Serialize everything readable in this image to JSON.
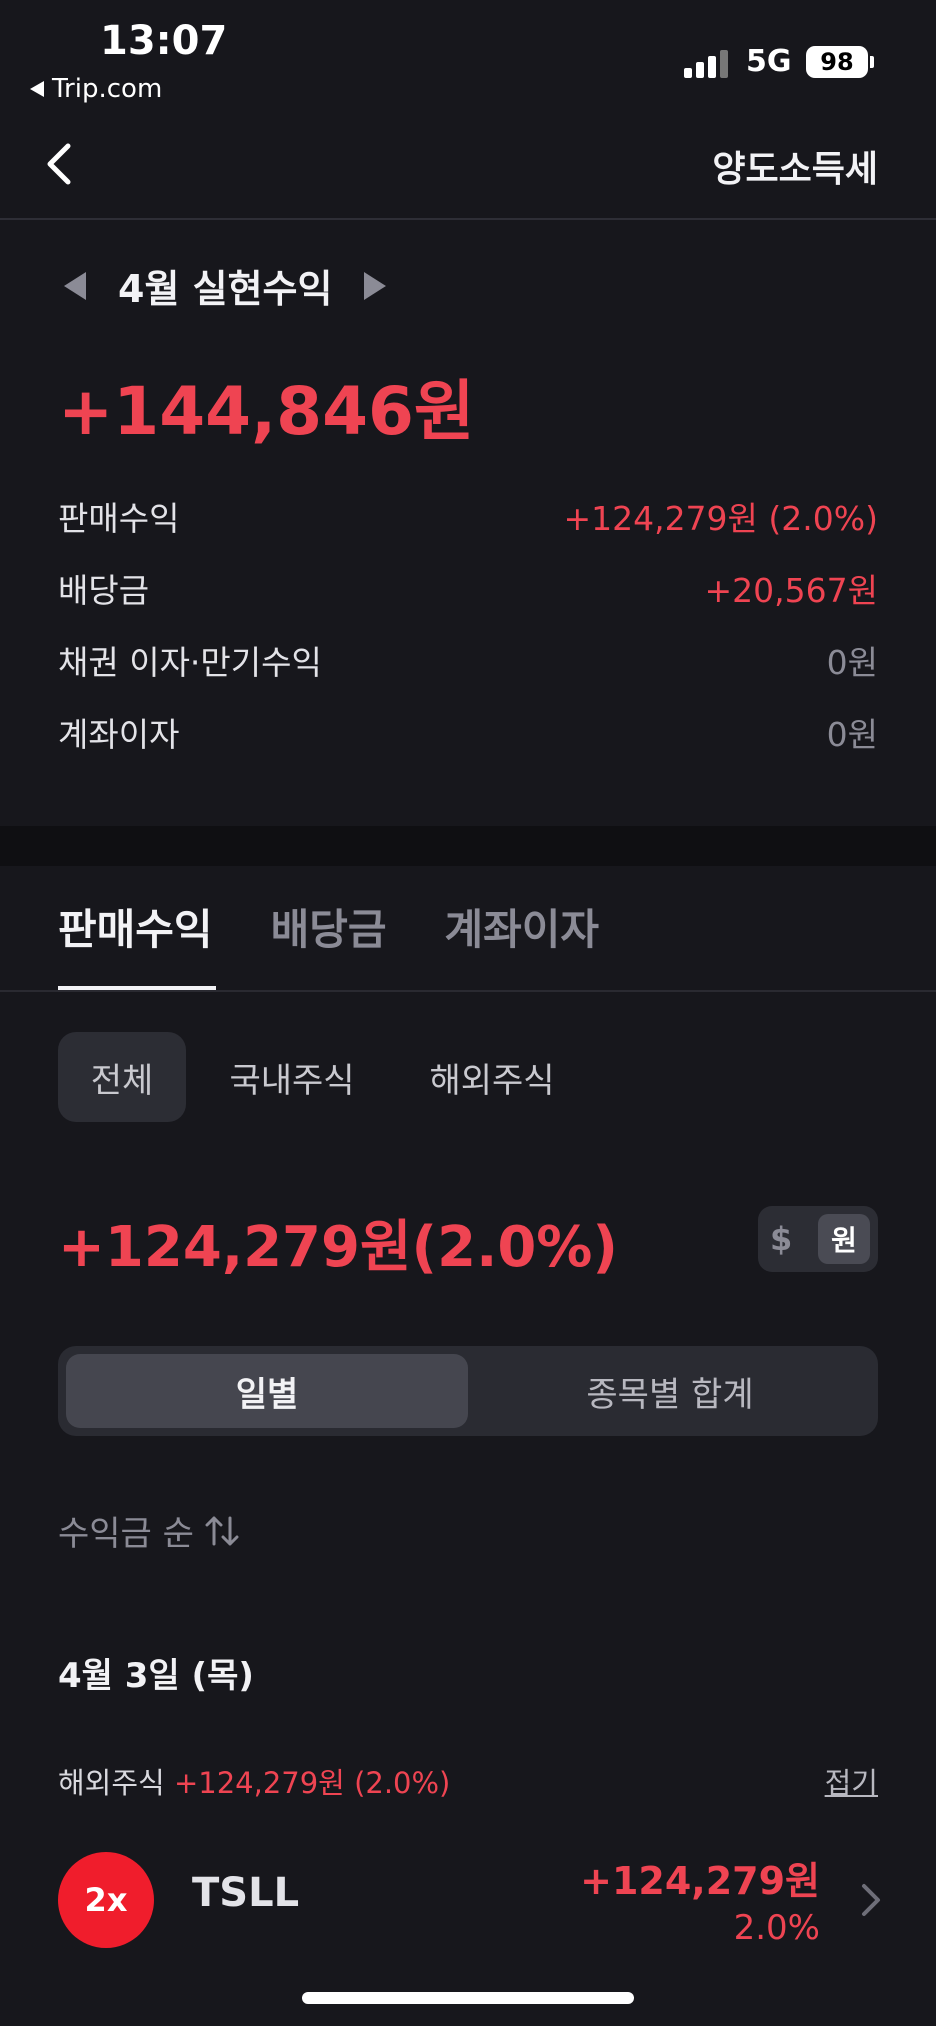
{
  "status_bar": {
    "time": "13:07",
    "back_app": "Trip.com",
    "network": "5G",
    "battery": "98"
  },
  "nav": {
    "title": "양도소득세"
  },
  "summary": {
    "month_label": "4월 실현수익",
    "total": "+144,846원",
    "rows": [
      {
        "label": "판매수익",
        "value": "+124,279원 (2.0%)"
      },
      {
        "label": "배당금",
        "value": "+20,567원"
      },
      {
        "label": "채권 이자·만기수익",
        "value": "0원"
      },
      {
        "label": "계좌이자",
        "value": "0원"
      }
    ]
  },
  "tabs": [
    "판매수익",
    "배당금",
    "계좌이자"
  ],
  "filters": [
    "전체",
    "국내주식",
    "해외주식"
  ],
  "sell_total": "+124,279원(2.0%)",
  "currency": {
    "usd": "$",
    "krw": "원"
  },
  "segment": {
    "left": "일별",
    "right": "종목별 합계"
  },
  "sort_label": "수익금 순",
  "date_header": "4월 3일 (목)",
  "group": {
    "label": "해외주식",
    "value": "+124,279원 (2.0%)",
    "collapse": "접기"
  },
  "stock": {
    "logo_text": "2x",
    "ticker": "TSLL",
    "amount": "+124,279원",
    "pct": "2.0%"
  },
  "colors": {
    "accent_red": "#ef4452",
    "background": "#17171c"
  }
}
